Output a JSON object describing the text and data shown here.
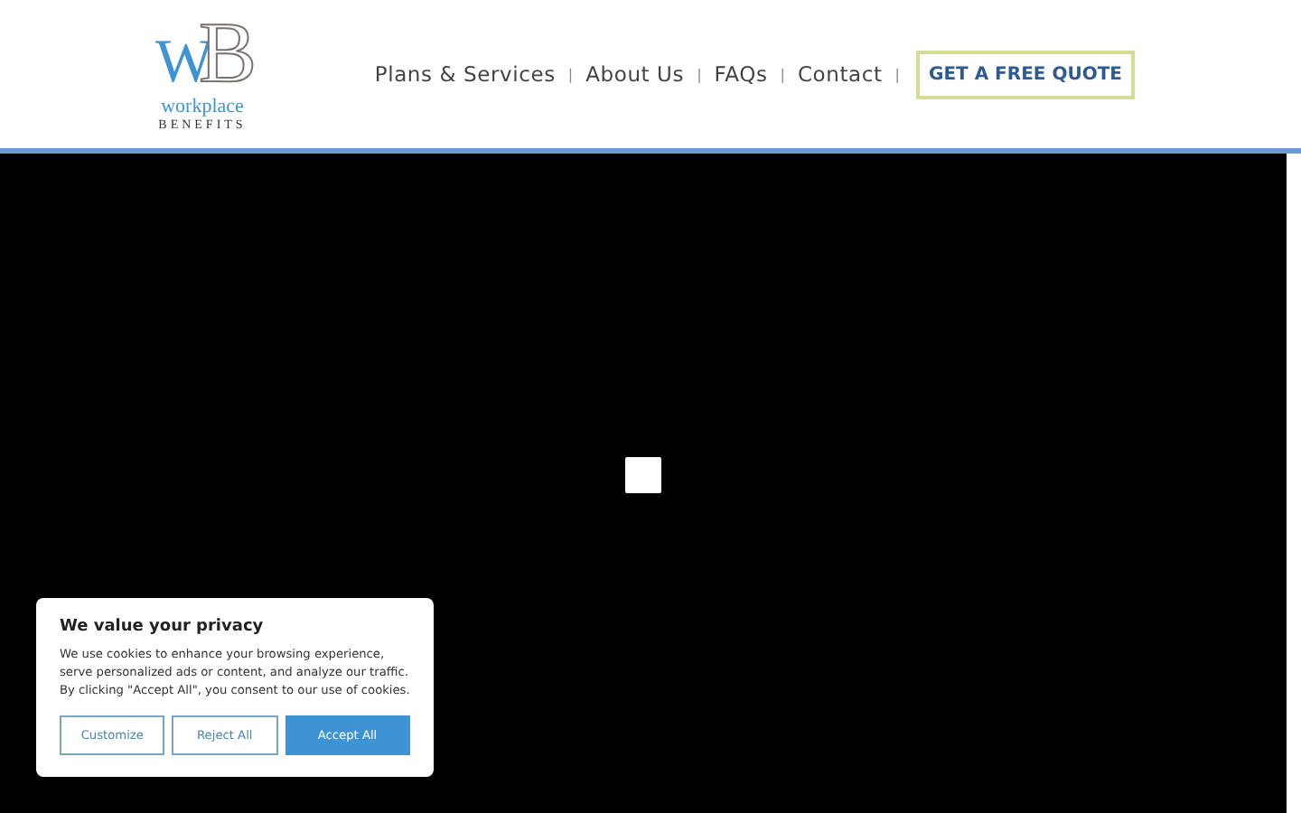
{
  "logo": {
    "letter_1": "W",
    "letter_2": "B",
    "line_1": "workplace",
    "line_2": "BENEFITS"
  },
  "nav": [
    {
      "label": "Plans & Services"
    },
    {
      "label": "About Us"
    },
    {
      "label": "FAQs"
    },
    {
      "label": "Contact"
    }
  ],
  "separator": "|",
  "cta": "GET A FREE QUOTE",
  "cookie_banner": {
    "title": "We value your privacy",
    "text": "We use cookies to enhance your browsing experience, serve personalized ads or content, and analyze our traffic. By clicking \"Accept All\", you consent to our use of cookies.",
    "buttons": [
      {
        "label": "Customize",
        "kind": "outline"
      },
      {
        "label": "Reject All",
        "kind": "outline"
      },
      {
        "label": "Accept All",
        "kind": "primary"
      }
    ]
  }
}
